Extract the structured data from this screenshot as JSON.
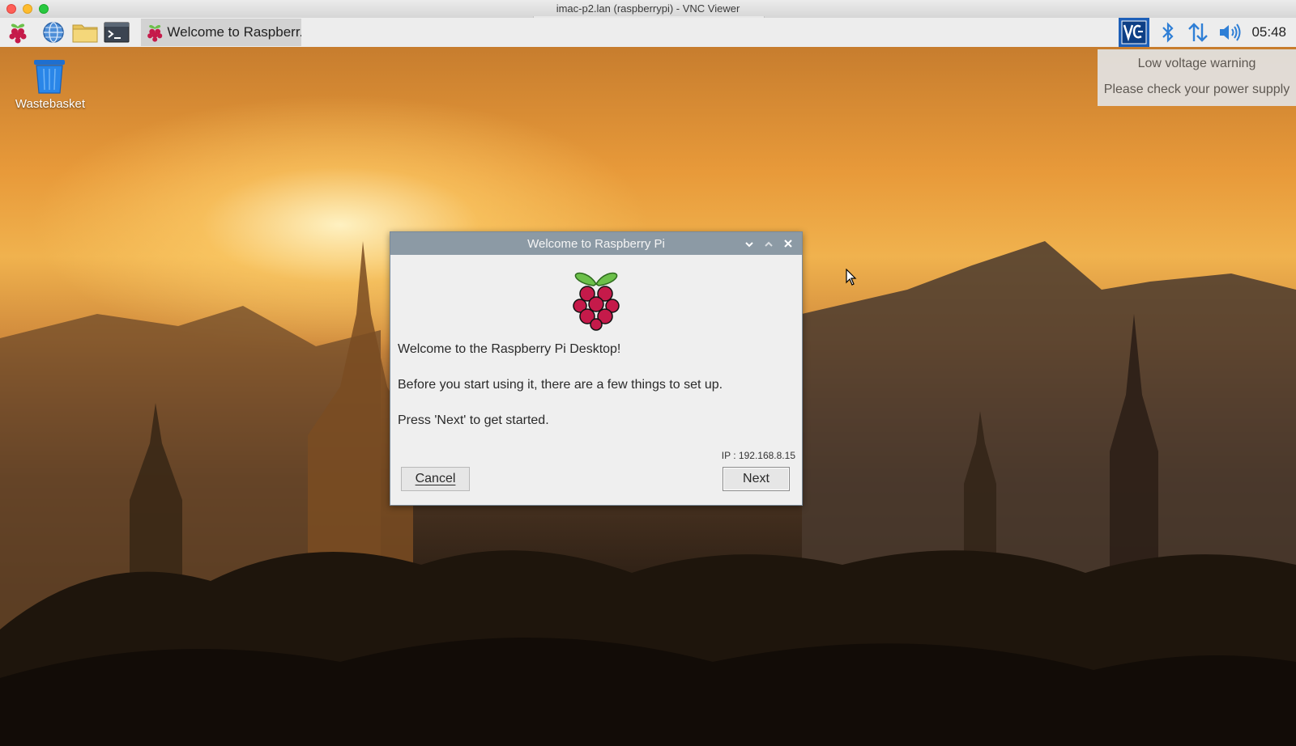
{
  "window": {
    "title": "imac-p2.lan (raspberrypi) - VNC Viewer"
  },
  "taskbar": {
    "launchers": [
      "raspberry-menu-icon",
      "web-browser-icon",
      "file-manager-icon",
      "terminal-icon"
    ],
    "task_label": "Welcome to Raspberr...",
    "tray_icons": [
      "vnc-server-icon",
      "bluetooth-icon",
      "network-icon",
      "volume-icon"
    ],
    "clock": "05:48"
  },
  "desktop": {
    "wastebasket_label": "Wastebasket"
  },
  "notification": {
    "line1": "Low voltage warning",
    "line2": "Please check your power supply"
  },
  "dialog": {
    "title": "Welcome to Raspberry Pi",
    "text1": "Welcome to the Raspberry Pi Desktop!",
    "text2": "Before you start using it, there are a few things to set up.",
    "text3": "Press 'Next' to get started.",
    "ip": "IP : 192.168.8.15",
    "cancel_label": "Cancel",
    "next_label": "Next"
  },
  "colors": {
    "taskbar": "#ededed",
    "dialog_title": "#8c9aa5",
    "raspberry": "#c51a4a",
    "leaf": "#6cc04a"
  }
}
